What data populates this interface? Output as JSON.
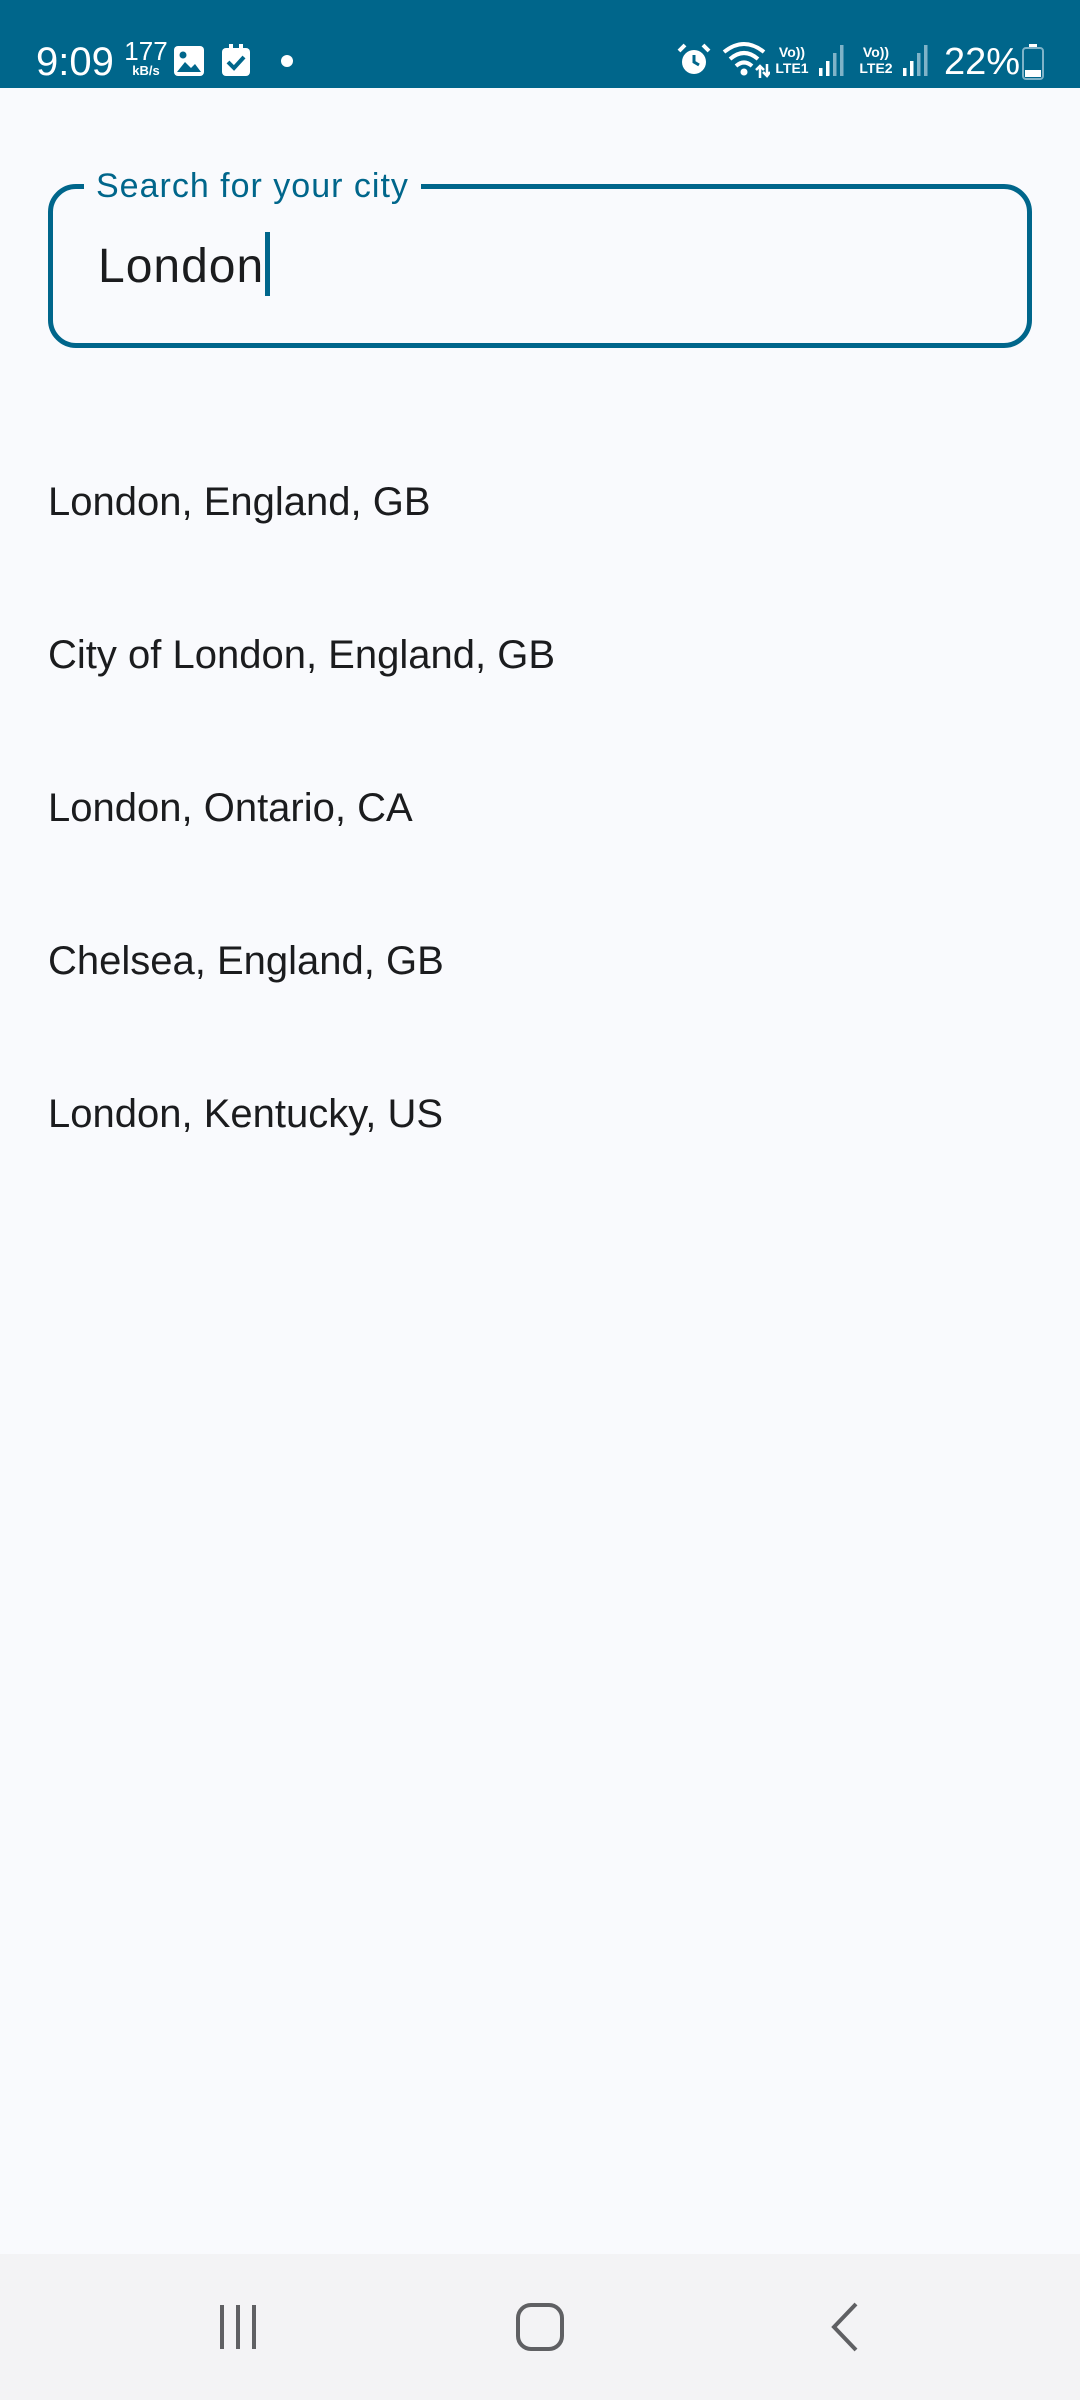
{
  "status_bar": {
    "time": "9:09",
    "net_speed_value": "177",
    "net_speed_unit": "kB/s",
    "sim1_label": "LTE1",
    "sim2_label": "LTE2",
    "volte_label": "Vo))",
    "battery_percent": "22%",
    "icons": [
      "gallery-icon",
      "check-icon",
      "dot-icon",
      "alarm-icon",
      "wifi-icon",
      "signal-icon",
      "battery-icon"
    ]
  },
  "search": {
    "label": "Search for your city",
    "value": "London",
    "accent_color": "#00668b"
  },
  "results": [
    {
      "label": "London, England, GB"
    },
    {
      "label": "City of London, England, GB"
    },
    {
      "label": "London, Ontario, CA"
    },
    {
      "label": "Chelsea, England, GB"
    },
    {
      "label": "London, Kentucky, US"
    }
  ],
  "nav_bar": {
    "buttons": [
      "recents-icon",
      "home-icon",
      "back-icon"
    ]
  }
}
